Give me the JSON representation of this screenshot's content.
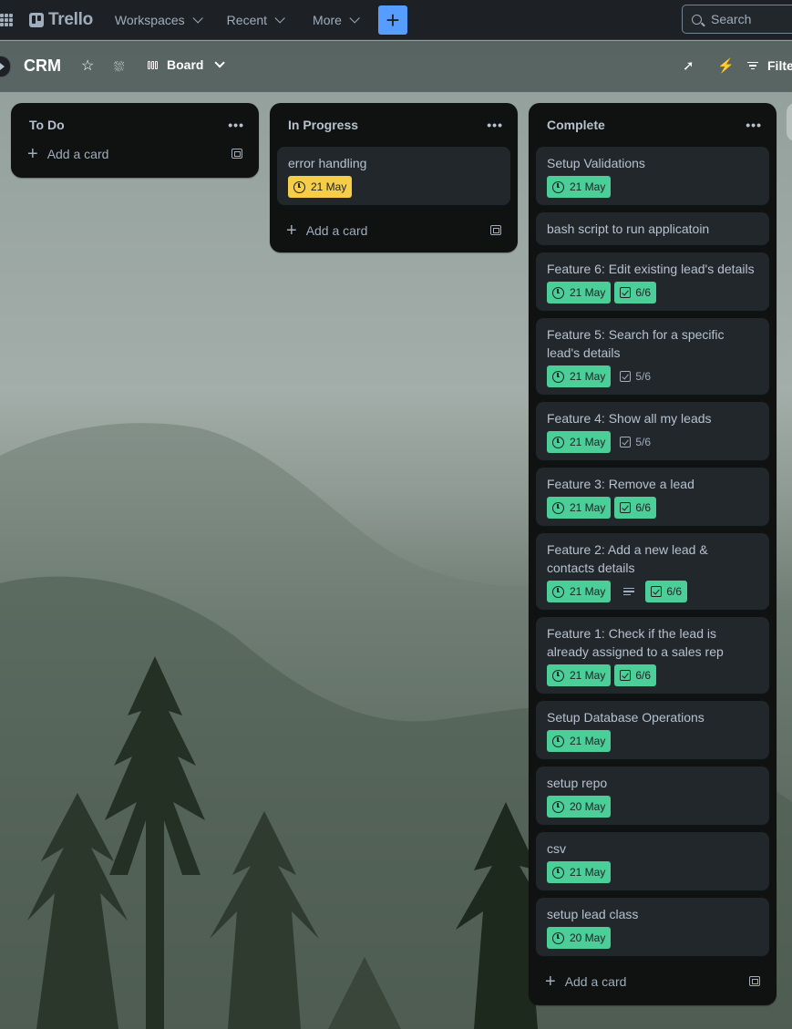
{
  "topnav": {
    "brand": "Trello",
    "menus": [
      "Workspaces",
      "Recent",
      "More"
    ],
    "search_placeholder": "Search"
  },
  "board": {
    "title": "CRM",
    "view": "Board",
    "filter_label": "Filte"
  },
  "lists": [
    {
      "title": "To Do",
      "add_card": "Add a card",
      "cards": []
    },
    {
      "title": "In Progress",
      "add_card": "Add a card",
      "cards": [
        {
          "title": "error handling",
          "date": "21 May",
          "date_color": "yellow"
        }
      ]
    },
    {
      "title": "Complete",
      "add_card": "Add a card",
      "cards": [
        {
          "title": "Setup Validations",
          "date": "21 May"
        },
        {
          "title": "bash script to run applicatoin"
        },
        {
          "title": "Feature 6: Edit existing lead's details",
          "date": "21 May",
          "checklist": "6/6",
          "checklist_complete": true
        },
        {
          "title": "Feature 5: Search for a specific lead's details",
          "date": "21 May",
          "checklist": "5/6",
          "checklist_complete": false
        },
        {
          "title": "Feature 4: Show all my leads",
          "date": "21 May",
          "checklist": "5/6",
          "checklist_complete": false
        },
        {
          "title": "Feature 3: Remove a lead",
          "date": "21 May",
          "checklist": "6/6",
          "checklist_complete": true
        },
        {
          "title": "Feature 2: Add a new lead & contacts details",
          "date": "21 May",
          "has_description": true,
          "checklist": "6/6",
          "checklist_complete": true
        },
        {
          "title": "Feature 1: Check if the lead is already assigned to a sales rep",
          "date": "21 May",
          "checklist": "6/6",
          "checklist_complete": true
        },
        {
          "title": "Setup Database Operations",
          "date": "21 May"
        },
        {
          "title": "setup repo",
          "date": "20 May"
        },
        {
          "title": "csv",
          "date": "21 May"
        },
        {
          "title": "setup lead class",
          "date": "20 May"
        }
      ]
    }
  ],
  "colors": {
    "nav_bg": "#1d2125",
    "list_bg": "#101204",
    "card_bg": "#22272b",
    "due_complete": "#4bce97",
    "due_soon": "#f5cd47",
    "create_button": "#579dff"
  }
}
